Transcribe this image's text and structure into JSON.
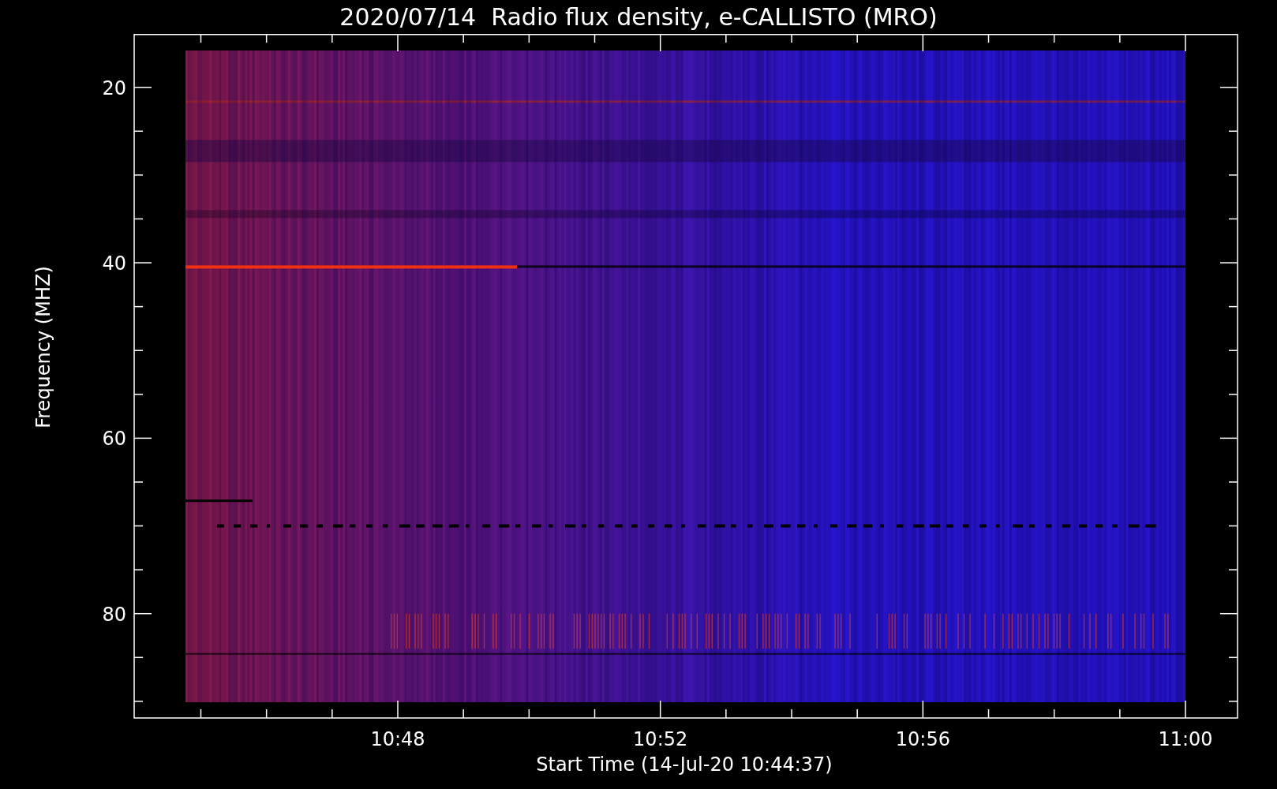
{
  "title": "2020/07/14  Radio flux density, e-CALLISTO (MRO)",
  "y_axis": {
    "label": "Frequency (MHZ)",
    "ticks": [
      "20",
      "40",
      "60",
      "80"
    ]
  },
  "x_axis": {
    "label": "Start Time (14-Jul-20 10:44:37)",
    "ticks": [
      "10:48",
      "10:52",
      "10:56",
      "11:00"
    ]
  }
}
